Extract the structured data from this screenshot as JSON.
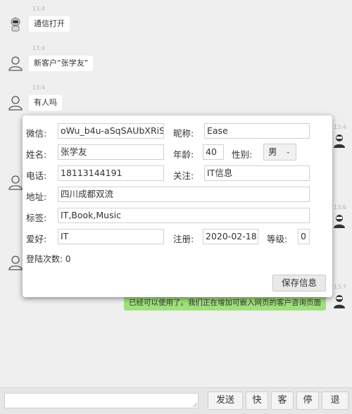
{
  "chat": {
    "messages": [
      {
        "time": "13:4",
        "text": "通信打开",
        "avatar": "robot-icon"
      },
      {
        "time": "13:4",
        "text": "新客户“张学友”",
        "avatar": "user-icon"
      },
      {
        "time": "13:4",
        "text": "有人吗",
        "avatar": "user-icon"
      }
    ],
    "right_times": [
      "13:4",
      "13:6",
      "13:7"
    ],
    "right_message": "已经可以使用了。我们正在增加可嵌入网页的客户咨询页面"
  },
  "profile": {
    "wechat_label": "微信:",
    "wechat_value": "oWu_b4u-aSqSAUbXRiS",
    "nickname_label": "昵称:",
    "nickname_value": "Ease",
    "name_label": "姓名:",
    "name_value": "张学友",
    "age_label": "年龄:",
    "age_value": "40",
    "gender_label": "性别:",
    "gender_value": "男",
    "phone_label": "电话:",
    "phone_value": "18113144191",
    "follow_label": "关注:",
    "follow_value": "IT信息",
    "address_label": "地址:",
    "address_value": "四川成都双流",
    "tags_label": "标签:",
    "tags_value": "IT,Book,Music",
    "hobby_label": "爱好:",
    "hobby_value": "IT",
    "register_label": "注册:",
    "register_value": "2020-02-18",
    "level_label": "等级:",
    "level_value": "0",
    "login_count": "登陆次数: 0",
    "save_label": "保存信息"
  },
  "bottom": {
    "send_label": "发送",
    "quick_label": "快",
    "client_label": "客",
    "stop_label": "停",
    "exit_label": "退"
  },
  "colors": {
    "bubble_right": "#9fe07c",
    "background": "#efefef"
  }
}
